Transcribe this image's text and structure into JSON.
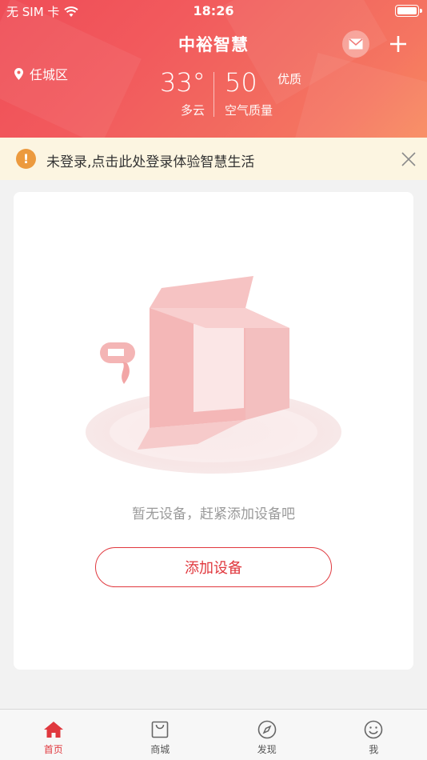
{
  "status_bar": {
    "carrier": "无 SIM 卡",
    "time": "18:26",
    "wifi_icon": "wifi-icon",
    "battery_icon": "battery-icon"
  },
  "header": {
    "title": "中裕智慧",
    "mail_icon": "mail-icon",
    "add_icon": "plus-icon",
    "location_icon": "location-pin-icon",
    "location": "任城区",
    "temperature": "33°",
    "weather": "多云",
    "aqi_value": "50",
    "aqi_level": "优质",
    "aqi_label": "空气质量"
  },
  "notice": {
    "icon": "warning-icon",
    "text": "未登录,点击此处登录体验智慧生活",
    "close_icon": "close-icon",
    "background": "#fcf5e1"
  },
  "device_card": {
    "illustration": "empty-box-illustration",
    "empty_message": "暂无设备，赶紧添加设备吧",
    "add_button": "添加设备"
  },
  "tabbar": {
    "items": [
      {
        "label": "首页",
        "icon": "home-icon",
        "active": true
      },
      {
        "label": "商城",
        "icon": "shopping-bag-icon",
        "active": false
      },
      {
        "label": "发现",
        "icon": "compass-icon",
        "active": false
      },
      {
        "label": "我",
        "icon": "smiley-face-icon",
        "active": false
      }
    ]
  },
  "colors": {
    "accent": "#e0383e",
    "header_gradient_start": "#ef4d57",
    "header_gradient_end": "#f88a5f",
    "warning": "#ec9a3e"
  }
}
